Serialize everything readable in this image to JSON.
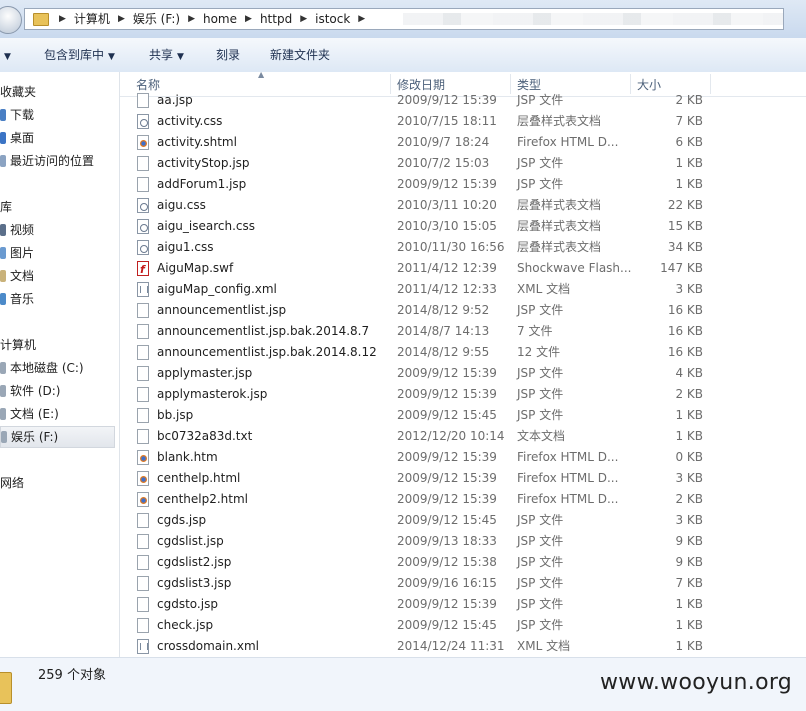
{
  "address": {
    "crumbs": [
      "计算机",
      "娱乐 (F:)",
      "home",
      "httpd",
      "istock"
    ]
  },
  "toolbar": {
    "include_library": "包含到库中",
    "share": "共享",
    "burn": "刻录",
    "new_folder": "新建文件夹"
  },
  "nav": {
    "favorites": "收藏夹",
    "downloads": "下载",
    "desktop": "桌面",
    "recent": "最近访问的位置",
    "libraries": "库",
    "videos": "视频",
    "pictures": "图片",
    "documents": "文档",
    "music": "音乐",
    "computer": "计算机",
    "drive_c": "本地磁盘 (C:)",
    "drive_d": "软件 (D:)",
    "drive_e": "文档 (E:)",
    "drive_f": "娱乐 (F:)",
    "network": "网络"
  },
  "columns": {
    "name": "名称",
    "date": "修改日期",
    "type": "类型",
    "size": "大小"
  },
  "files": [
    {
      "name": "aa.jsp",
      "date": "2009/9/12 15:39",
      "type": "JSP 文件",
      "size": "2 KB",
      "icon": "doc"
    },
    {
      "name": "activity.css",
      "date": "2010/7/15 18:11",
      "type": "层叠样式表文档",
      "size": "7 KB",
      "icon": "css"
    },
    {
      "name": "activity.shtml",
      "date": "2010/9/7 18:24",
      "type": "Firefox HTML D...",
      "size": "6 KB",
      "icon": "html"
    },
    {
      "name": "activityStop.jsp",
      "date": "2010/7/2 15:03",
      "type": "JSP 文件",
      "size": "1 KB",
      "icon": "doc"
    },
    {
      "name": "addForum1.jsp",
      "date": "2009/9/12 15:39",
      "type": "JSP 文件",
      "size": "1 KB",
      "icon": "doc"
    },
    {
      "name": "aigu.css",
      "date": "2010/3/11 10:20",
      "type": "层叠样式表文档",
      "size": "22 KB",
      "icon": "css"
    },
    {
      "name": "aigu_isearch.css",
      "date": "2010/3/10 15:05",
      "type": "层叠样式表文档",
      "size": "15 KB",
      "icon": "css"
    },
    {
      "name": "aigu1.css",
      "date": "2010/11/30 16:56",
      "type": "层叠样式表文档",
      "size": "34 KB",
      "icon": "css"
    },
    {
      "name": "AiguMap.swf",
      "date": "2011/4/12 12:39",
      "type": "Shockwave Flash...",
      "size": "147 KB",
      "icon": "swf"
    },
    {
      "name": "aiguMap_config.xml",
      "date": "2011/4/12 12:33",
      "type": "XML 文档",
      "size": "3 KB",
      "icon": "xml"
    },
    {
      "name": "announcementlist.jsp",
      "date": "2014/8/12 9:52",
      "type": "JSP 文件",
      "size": "16 KB",
      "icon": "doc"
    },
    {
      "name": "announcementlist.jsp.bak.2014.8.7",
      "date": "2014/8/7 14:13",
      "type": "7 文件",
      "size": "16 KB",
      "icon": "doc"
    },
    {
      "name": "announcementlist.jsp.bak.2014.8.12",
      "date": "2014/8/12 9:55",
      "type": "12 文件",
      "size": "16 KB",
      "icon": "doc"
    },
    {
      "name": "applymaster.jsp",
      "date": "2009/9/12 15:39",
      "type": "JSP 文件",
      "size": "4 KB",
      "icon": "doc"
    },
    {
      "name": "applymasterok.jsp",
      "date": "2009/9/12 15:39",
      "type": "JSP 文件",
      "size": "2 KB",
      "icon": "doc"
    },
    {
      "name": "bb.jsp",
      "date": "2009/9/12 15:45",
      "type": "JSP 文件",
      "size": "1 KB",
      "icon": "doc"
    },
    {
      "name": "bc0732a83d.txt",
      "date": "2012/12/20 10:14",
      "type": "文本文档",
      "size": "1 KB",
      "icon": "doc"
    },
    {
      "name": "blank.htm",
      "date": "2009/9/12 15:39",
      "type": "Firefox HTML D...",
      "size": "0 KB",
      "icon": "html"
    },
    {
      "name": "centhelp.html",
      "date": "2009/9/12 15:39",
      "type": "Firefox HTML D...",
      "size": "3 KB",
      "icon": "html"
    },
    {
      "name": "centhelp2.html",
      "date": "2009/9/12 15:39",
      "type": "Firefox HTML D...",
      "size": "2 KB",
      "icon": "html"
    },
    {
      "name": "cgds.jsp",
      "date": "2009/9/12 15:45",
      "type": "JSP 文件",
      "size": "3 KB",
      "icon": "doc"
    },
    {
      "name": "cgdslist.jsp",
      "date": "2009/9/13 18:33",
      "type": "JSP 文件",
      "size": "9 KB",
      "icon": "doc"
    },
    {
      "name": "cgdslist2.jsp",
      "date": "2009/9/12 15:38",
      "type": "JSP 文件",
      "size": "9 KB",
      "icon": "doc"
    },
    {
      "name": "cgdslist3.jsp",
      "date": "2009/9/16 16:15",
      "type": "JSP 文件",
      "size": "7 KB",
      "icon": "doc"
    },
    {
      "name": "cgdsto.jsp",
      "date": "2009/9/12 15:39",
      "type": "JSP 文件",
      "size": "1 KB",
      "icon": "doc"
    },
    {
      "name": "check.jsp",
      "date": "2009/9/12 15:45",
      "type": "JSP 文件",
      "size": "1 KB",
      "icon": "doc"
    },
    {
      "name": "crossdomain.xml",
      "date": "2014/12/24 11:31",
      "type": "XML 文档",
      "size": "1 KB",
      "icon": "xml"
    }
  ],
  "status": {
    "count": "259 个对象",
    "watermark": "www.wooyun.org"
  }
}
